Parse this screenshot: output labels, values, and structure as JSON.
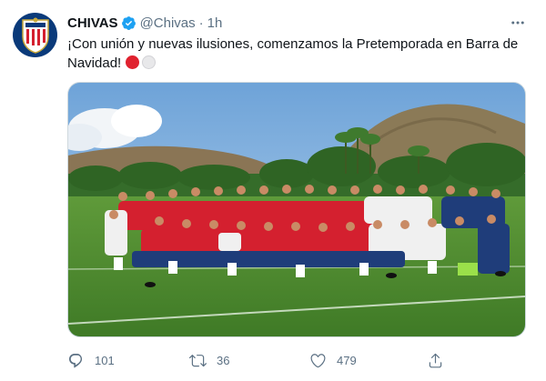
{
  "tweet": {
    "display_name": "CHIVAS",
    "handle": "@Chivas",
    "separator": "·",
    "time": "1h",
    "text": "¡Con unión y nuevas ilusiones, comenzamos la Pretemporada en Barra de Navidad!",
    "emojis": [
      "red-circle",
      "white-circle"
    ]
  },
  "actions": {
    "replies": "101",
    "retweets": "36",
    "likes": "479"
  },
  "colors": {
    "secondary_text": "#5b7083",
    "verified_badge": "#1da1f2",
    "jersey_red": "#d4202f",
    "brand_blue": "#0a3a7a"
  }
}
